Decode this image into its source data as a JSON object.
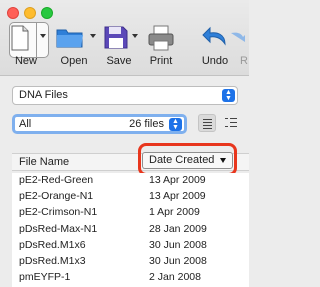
{
  "toolbar": {
    "new_label": "New",
    "open_label": "Open",
    "save_label": "Save",
    "print_label": "Print",
    "undo_label": "Undo",
    "redo_label": "R"
  },
  "collection": {
    "value": "DNA Files"
  },
  "filter": {
    "value": "All",
    "count": "26 files"
  },
  "table": {
    "columns": {
      "name": "File Name",
      "date": "Date Created"
    },
    "rows": [
      {
        "name": "pE2-Red-Green",
        "date": "13 Apr 2009"
      },
      {
        "name": "pE2-Orange-N1",
        "date": "13 Apr 2009"
      },
      {
        "name": "pE2-Crimson-N1",
        "date": "1 Apr 2009"
      },
      {
        "name": "pDsRed-Max-N1",
        "date": "28 Jan 2009"
      },
      {
        "name": "pDsRed.M1x6",
        "date": "30 Jun 2008"
      },
      {
        "name": "pDsRed.M1x3",
        "date": "30 Jun 2008"
      },
      {
        "name": "pmEYFP-1",
        "date": "2 Jan 2008"
      }
    ]
  },
  "colors": {
    "accent": "#1d72e8",
    "highlight": "#e8361d",
    "focus_ring": "#7fb0ee"
  }
}
